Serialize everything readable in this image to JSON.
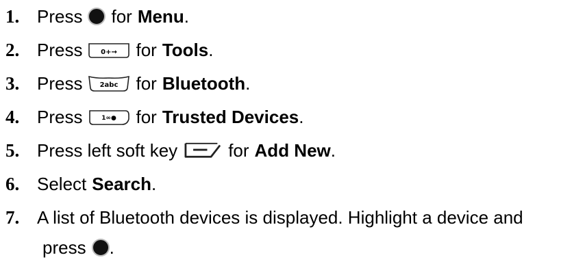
{
  "steps": [
    {
      "num": "1.",
      "pre": "Press",
      "post": "for",
      "bold": "Menu",
      "end": ".",
      "icon": "center-select-dot-icon"
    },
    {
      "num": "2.",
      "pre": "Press",
      "post": "for",
      "bold": "Tools",
      "end": ".",
      "icon": "zero-key-icon"
    },
    {
      "num": "3.",
      "pre": "Press",
      "post": "for",
      "bold": "Bluetooth",
      "end": ".",
      "icon": "two-abc-key-icon"
    },
    {
      "num": "4.",
      "pre": "Press",
      "post": "for",
      "bold": "Trusted Devices",
      "end": ".",
      "icon": "one-key-icon"
    },
    {
      "num": "5.",
      "pre": "Press left soft key",
      "post": "for",
      "bold": "Add New",
      "end": ".",
      "icon": "left-soft-key-icon"
    },
    {
      "num": "6.",
      "pre": "Select",
      "bold": "Search",
      "end": "."
    },
    {
      "num": "7.",
      "pre": "A list of Bluetooth devices is displayed. Highlight a device and",
      "cont": "press",
      "end": ".",
      "icon": "center-select-dot-icon"
    }
  ],
  "key_labels": {
    "zero": "0+→",
    "two": "2abc",
    "one": "1∞●"
  }
}
